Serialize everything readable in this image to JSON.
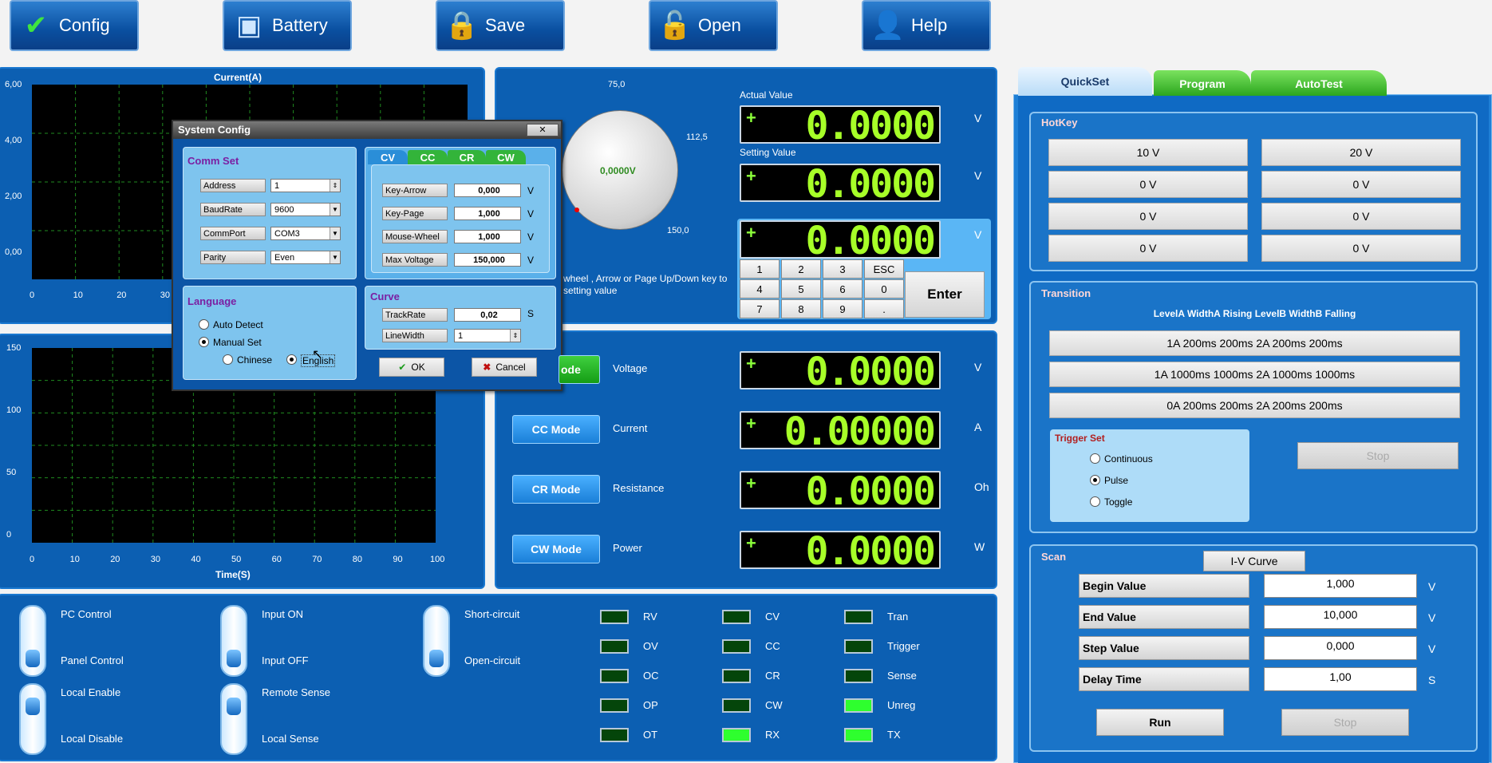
{
  "toolbar": {
    "config": "Config",
    "battery": "Battery",
    "save": "Save",
    "open": "Open",
    "help": "Help"
  },
  "chart_data": [
    {
      "type": "line",
      "title": "Current(A)",
      "xlabel": "",
      "ylabel": "",
      "ylim": [
        -0.5,
        6
      ],
      "xlim": [
        0,
        100
      ],
      "y_ticks": [
        "6,00",
        "4,00",
        "2,00",
        "0,00"
      ],
      "x_ticks": [
        "0",
        "10",
        "20",
        "30"
      ],
      "series": []
    },
    {
      "type": "line",
      "title": "",
      "xlabel": "Time(S)",
      "ylabel": "",
      "ylim": [
        0,
        150
      ],
      "xlim": [
        0,
        100
      ],
      "y_ticks": [
        "150",
        "100",
        "50",
        "0"
      ],
      "x_ticks": [
        "0",
        "10",
        "20",
        "30",
        "40",
        "50",
        "60",
        "70",
        "80",
        "90",
        "100"
      ],
      "series": []
    }
  ],
  "knob": {
    "value": "0,0000V",
    "mark_top": "75,0",
    "mark_right": "112,5",
    "mark_bottom": "150,0",
    "hint1": "wheel , Arrow or Page Up/Down key to",
    "hint2": "setting value"
  },
  "display": {
    "actual_label": "Actual Value",
    "setting_label": "Setting Value",
    "actual": "0.0000",
    "actual_unit": "V",
    "setting": "0.0000",
    "setting_unit": "V",
    "entry": "0.0000",
    "entry_unit": "V",
    "sign": "+"
  },
  "keypad": {
    "keys": [
      "1",
      "2",
      "3",
      "ESC",
      "4",
      "5",
      "6",
      "0",
      "7",
      "8",
      "9",
      "."
    ],
    "enter": "Enter"
  },
  "modes": [
    {
      "button": "CV Mode",
      "button_visible": "ode",
      "label": "Voltage",
      "value": "0.0000",
      "unit": "V"
    },
    {
      "button": "CC Mode",
      "label": "Current",
      "value": "0.00000",
      "unit": "A"
    },
    {
      "button": "CR Mode",
      "label": "Resistance",
      "value": "0.0000",
      "unit": "Oh"
    },
    {
      "button": "CW Mode",
      "label": "Power",
      "value": "0.0000",
      "unit": "W"
    }
  ],
  "switches": [
    {
      "top": "PC Control",
      "bottom": "Panel Control"
    },
    {
      "top": "Input ON",
      "bottom": "Input OFF"
    },
    {
      "top": "Short-circuit",
      "bottom": "Open-circuit"
    },
    {
      "top": "Local Enable",
      "bottom": "Local Disable"
    },
    {
      "top": "Remote Sense",
      "bottom": "Local Sense"
    }
  ],
  "leds": [
    {
      "label": "RV",
      "on": false
    },
    {
      "label": "CV",
      "on": false
    },
    {
      "label": "Tran",
      "on": false
    },
    {
      "label": "OV",
      "on": false
    },
    {
      "label": "CC",
      "on": false
    },
    {
      "label": "Trigger",
      "on": false
    },
    {
      "label": "OC",
      "on": false
    },
    {
      "label": "CR",
      "on": false
    },
    {
      "label": "Sense",
      "on": false
    },
    {
      "label": "OP",
      "on": false
    },
    {
      "label": "CW",
      "on": false
    },
    {
      "label": "Unreg",
      "on": true
    },
    {
      "label": "OT",
      "on": false
    },
    {
      "label": "RX",
      "on": true
    },
    {
      "label": "TX",
      "on": true
    }
  ],
  "right": {
    "tabs": [
      "QuickSet",
      "Program",
      "AutoTest"
    ],
    "hotkey_title": "HotKey",
    "hotkeys": [
      "10 V",
      "20 V",
      "0 V",
      "0 V",
      "0 V",
      "0 V",
      "0 V",
      "0 V"
    ],
    "transition_title": "Transition",
    "transition_header": "LevelA WidthA Rising LevelB WidthB Falling",
    "transitions": [
      "1A 200ms 200ms 2A 200ms 200ms",
      "1A 1000ms 1000ms 2A 1000ms 1000ms",
      "0A 200ms 200ms 2A 200ms 200ms"
    ],
    "trigger_title": "Trigger Set",
    "trigger_options": [
      "Continuous",
      "Pulse",
      "Toggle"
    ],
    "trigger_selected": "Pulse",
    "stop": "Stop",
    "scan_title": "Scan",
    "scan_button": "I-V Curve",
    "scan_rows": [
      {
        "label": "Begin Value",
        "value": "1,000",
        "unit": "V"
      },
      {
        "label": "End Value",
        "value": "10,000",
        "unit": "V"
      },
      {
        "label": "Step Value",
        "value": "0,000",
        "unit": "V"
      },
      {
        "label": "Delay Time",
        "value": "1,00",
        "unit": "S"
      }
    ],
    "run": "Run",
    "scan_stop": "Stop"
  },
  "dialog": {
    "title": "System Config",
    "close": "✕",
    "comm_title": "Comm Set",
    "comm": [
      {
        "label": "Address",
        "value": "1"
      },
      {
        "label": "BaudRate",
        "value": "9600"
      },
      {
        "label": "CommPort",
        "value": "COM3"
      },
      {
        "label": "Parity",
        "value": "Even"
      }
    ],
    "tabs": [
      "CV",
      "CC",
      "CR",
      "CW"
    ],
    "steps": [
      {
        "label": "Key-Arrow",
        "value": "0,000",
        "unit": "V"
      },
      {
        "label": "Key-Page",
        "value": "1,000",
        "unit": "V"
      },
      {
        "label": "Mouse-Wheel",
        "value": "1,000",
        "unit": "V"
      },
      {
        "label": "Max Voltage",
        "value": "150,000",
        "unit": "V"
      }
    ],
    "language_title": "Language",
    "auto_detect": "Auto Detect",
    "manual_set": "Manual Set",
    "chinese": "Chinese",
    "english": "English",
    "curve_title": "Curve",
    "track_label": "TrackRate",
    "track_value": "0,02",
    "track_unit": "S",
    "line_label": "LineWidth",
    "line_value": "1",
    "ok": "OK",
    "cancel": "Cancel"
  },
  "colors": {
    "panel": "#0c5fb2",
    "lcd_digits": "#a7ff28",
    "dialog_group": "#7ec4ee",
    "accent_green": "#1fbf1f"
  }
}
